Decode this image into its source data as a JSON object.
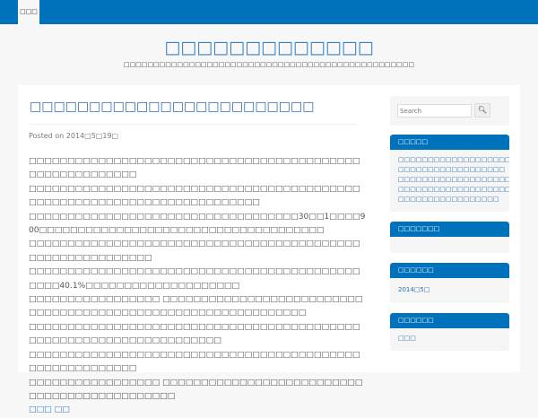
{
  "nav": {
    "home": "□□□"
  },
  "site": {
    "title": "□□□□□□□□□□□□□",
    "tagline": "□□□□□□□□□□□□□□□□□□□□□□□□□□□□□□□□□□□□□□□□□□□□□□□□□"
  },
  "post": {
    "title": "□□□□□□□□□□□□□□□□□□□□□□□□",
    "posted": "Posted on 2014□5□19□",
    "paragraphs": [
      "□□□□□□□□□□□□□□□□□□□□□□□□□□□□□□□□□□□□□□□□□□□□□□□□□□□□□□□□□",
      "□□□□□□□□□□□□□□□□□□□□□□□□□□□□□□□□□□□□□□□□□□□□□□□□□□□□□□□□□□□□□□□□□□□□□□□□□",
      "□□□□□□□□□□□□□□□□□□□□□□□□□□□□□□□□□□□30□□1□□□□900□□□□□□□□□□□□□□□□□□□□□□□□□□□□□□□□□□□□□",
      "□□□□□□□□□□□□□□□□□□□□□□□□□□□□□□□□□□□□□□□□□□□□□□□□□□□□□□□□□□□",
      "□□□□□□□□□□□□□□□□□□□□□□□□□□□□□□□□□□□□□□□□□□□□□□□40.1%□□□□□□□□□□□□□□□□□□□□",
      "□□□□□□□□□□□□□□□□□ □□□□□□□□□□□□□□□□□□□□□□□□□□□□□□□□□□□□□□□□□□□□□□□□□□□□□□□□□□□□□□",
      "□□□□□□□□□□□□□□□□□□□□□□□□□□□□□□□□□□□□□□□□□□□□□□□□□□□□□□□□□□□□□□□□□□□□",
      "□□□□□□□□□□□□□□□□□□□□□□□□□□□□□□□□□□□□□□□□□□□□□□□□□□□□□□□□□",
      "□□□□□□□□□□□□□□□□□ □□□□□□□□□□□□□□□□□□□□□□□□□□□□□□□□□□□□□□□□□□□□□"
    ],
    "more": "□□□ □□"
  },
  "sidebar": {
    "search_placeholder": "Search",
    "search_icon": "magnifier",
    "widgets": [
      {
        "title": "□□□□□",
        "items": [
          "□□□□□□□□□□□□□□□□□□□",
          "□□□□□□□□□□□□□□□□□□",
          "□□□□□□□□□□□□□□□□□□□",
          "□□□□□□□□□□□□□□□□□□□□",
          "□□□□□□□□□□□□□□□□□"
        ]
      },
      {
        "title": "□□□□□□□",
        "items": []
      },
      {
        "title": "□□□□□□",
        "items": [
          "2014□5□"
        ]
      },
      {
        "title": "□□□□□□",
        "items": [
          "□□□"
        ]
      }
    ]
  }
}
